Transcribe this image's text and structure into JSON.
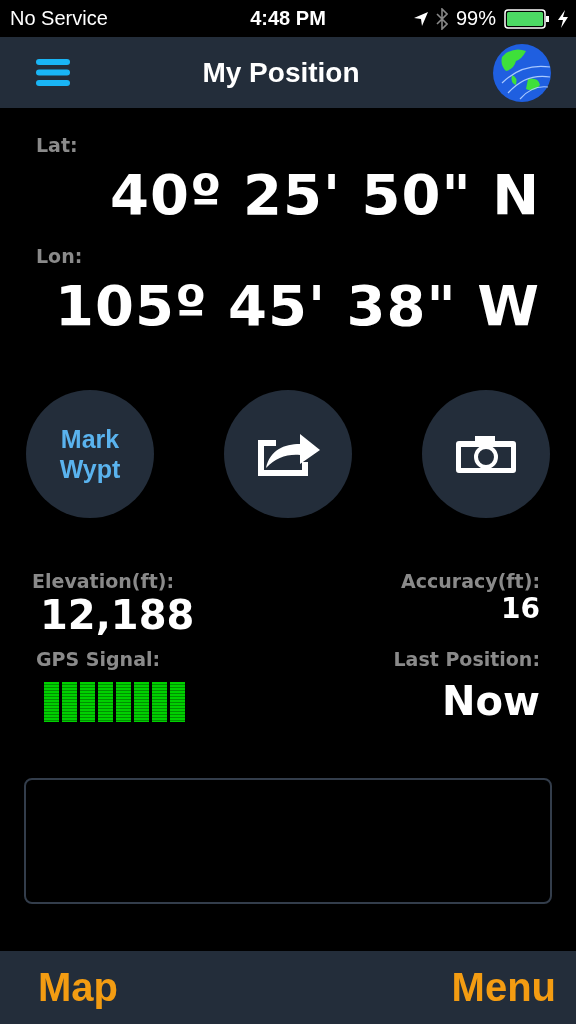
{
  "status_bar": {
    "carrier": "No Service",
    "time": "4:48 PM",
    "battery": "99%"
  },
  "nav_bar": {
    "title": "My Position"
  },
  "position": {
    "lat_label": "Lat:",
    "lat": "40º 25' 50\" N",
    "lon_label": "Lon:",
    "lon": "105º 45' 38\" W"
  },
  "actions": [
    {
      "kind": "text",
      "label": "Mark Wypt"
    },
    {
      "kind": "share"
    },
    {
      "kind": "camera"
    }
  ],
  "stats": {
    "elevation_label": "Elevation(ft):",
    "elevation": "12,188",
    "accuracy_label": "Accuracy(ft):",
    "accuracy": "16",
    "gps_label": "GPS Signal:",
    "gps": {
      "level": 1
    },
    "last_label": "Last Position:",
    "last": "Now"
  },
  "bottom_bar": {
    "left": "Map",
    "right": "Menu"
  }
}
